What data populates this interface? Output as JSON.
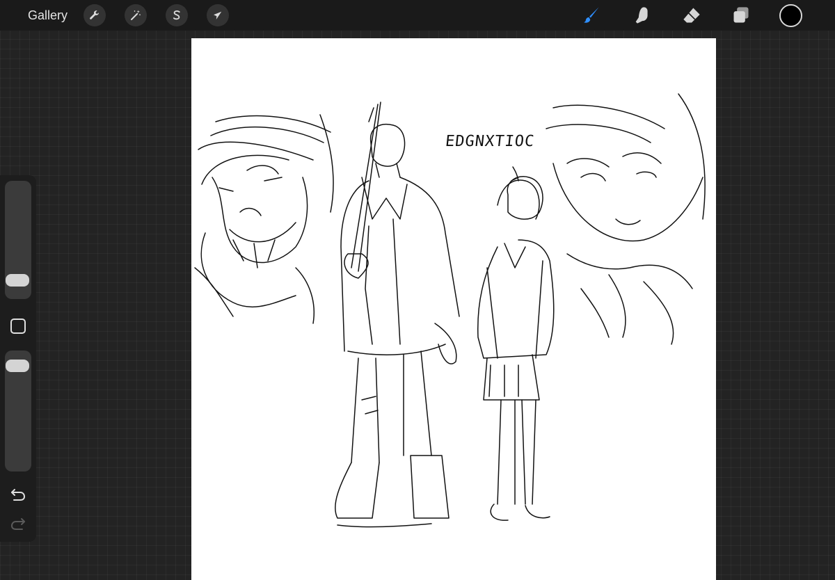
{
  "toolbar": {
    "gallery_label": "Gallery",
    "left_tools": [
      {
        "name": "actions",
        "icon": "wrench-icon"
      },
      {
        "name": "adjustments",
        "icon": "magic-wand-icon"
      },
      {
        "name": "selection",
        "icon": "selection-s-icon"
      },
      {
        "name": "transform",
        "icon": "transform-arrow-icon"
      }
    ],
    "right_tools": [
      {
        "name": "brush",
        "icon": "brush-icon",
        "active": true
      },
      {
        "name": "smudge",
        "icon": "smudge-finger-icon",
        "active": false
      },
      {
        "name": "eraser",
        "icon": "eraser-icon",
        "active": false
      },
      {
        "name": "layers",
        "icon": "layers-icon",
        "active": false
      }
    ],
    "current_color": "#000000",
    "accent_color": "#2f8fff"
  },
  "canvas": {
    "title_text": "EDGNXTIOC",
    "background": "#ffffff"
  },
  "sidebar": {
    "brush_size_level": 0.15,
    "opacity_level": 0.95,
    "icons": [
      "modify-square-icon",
      "undo-icon",
      "redo-icon"
    ]
  }
}
